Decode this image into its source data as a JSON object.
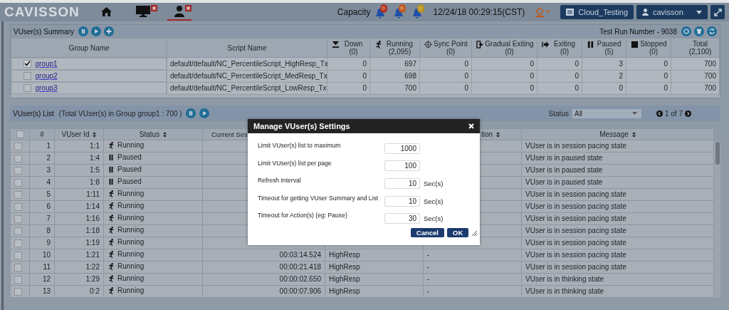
{
  "topbar": {
    "logo": "CAVISSON",
    "tabs": [
      {
        "kind": "home",
        "selected": false,
        "closable": false
      },
      {
        "kind": "monitor",
        "selected": false,
        "closable": true
      },
      {
        "kind": "user",
        "selected": true,
        "closable": true
      }
    ],
    "capacity_label": "Capacity",
    "alerts": [
      {
        "count": "0",
        "color": "#b3321f"
      },
      {
        "count": "0",
        "color": "#c0571f"
      },
      {
        "count": "0",
        "color": "#b8911c"
      }
    ],
    "datetime": "12/24/18 00:29:15(CST)",
    "project_button": "Cloud_Testing",
    "user_button": "cavisson"
  },
  "summary": {
    "title": "VUser(s) Summary",
    "test_run": "Test Run Number - 9038",
    "columns": [
      {
        "label": "Group Name",
        "kind": "text"
      },
      {
        "label": "Script Name",
        "kind": "text"
      },
      {
        "label": "Down",
        "count": "(0)",
        "kind": "down"
      },
      {
        "label": "Running",
        "count": "(2,095)",
        "kind": "running"
      },
      {
        "label": "Sync Point",
        "count": "(0)",
        "kind": "sync"
      },
      {
        "label": "Gradual Exiting",
        "count": "(0)",
        "kind": "gradual"
      },
      {
        "label": "Exiting",
        "count": "(0)",
        "kind": "exiting"
      },
      {
        "label": "Paused",
        "count": "(5)",
        "kind": "paused"
      },
      {
        "label": "Stopped",
        "count": "(0)",
        "kind": "stopped"
      },
      {
        "label": "Total",
        "count": "(2,100)",
        "kind": "total"
      }
    ],
    "rows": [
      {
        "checked": true,
        "group": "group1",
        "script": "default/default/NC_PercentileScript_HighResp_Tx",
        "values": [
          "0",
          "697",
          "0",
          "0",
          "0",
          "3",
          "0",
          "700"
        ]
      },
      {
        "checked": false,
        "group": "group2",
        "script": "default/default/NC_PercentileScript_MedResp_Tx",
        "values": [
          "0",
          "698",
          "0",
          "0",
          "0",
          "2",
          "0",
          "700"
        ]
      },
      {
        "checked": false,
        "group": "group3",
        "script": "default/default/NC_PercentileScript_LowResp_Tx",
        "values": [
          "0",
          "700",
          "0",
          "0",
          "0",
          "0",
          "0",
          "700"
        ]
      }
    ]
  },
  "vuser_list": {
    "title": "VUser(s) List",
    "subtitle": "(Total VUser(s) in Group group1 : 700 )",
    "status_filter": {
      "label": "Status",
      "value": "All"
    },
    "pager": "1 of 7",
    "all_checked": false,
    "columns": [
      {
        "label": "#",
        "sortable": false
      },
      {
        "label": "VUser Id",
        "sortable": true
      },
      {
        "label": "Status",
        "sortable": true
      },
      {
        "label": "Current Ses"
      },
      {
        "label": "tion",
        "sortable": true
      },
      {
        "label": "Message",
        "sortable": true
      }
    ],
    "rows": [
      {
        "checked": false,
        "num": "1",
        "id": "1:1",
        "status": {
          "kind": "running",
          "label": "Running"
        },
        "message": "VUser is in session pacing state"
      },
      {
        "checked": false,
        "num": "2",
        "id": "1:4",
        "status": {
          "kind": "paused",
          "label": "Paused"
        },
        "message": "VUser is in paused state"
      },
      {
        "checked": false,
        "num": "3",
        "id": "1:5",
        "status": {
          "kind": "paused",
          "label": "Paused"
        },
        "message": "VUser is in paused state"
      },
      {
        "checked": false,
        "num": "4",
        "id": "1:8",
        "status": {
          "kind": "paused",
          "label": "Paused"
        },
        "message": "VUser is in paused state"
      },
      {
        "checked": false,
        "num": "5",
        "id": "1:11",
        "status": {
          "kind": "running",
          "label": "Running"
        },
        "message": "VUser is in session pacing state"
      },
      {
        "checked": false,
        "num": "6",
        "id": "1:14",
        "status": {
          "kind": "running",
          "label": "Running"
        },
        "message": "VUser is in session pacing state"
      },
      {
        "checked": false,
        "num": "7",
        "id": "1:16",
        "status": {
          "kind": "running",
          "label": "Running"
        },
        "message": "VUser is in session pacing state"
      },
      {
        "checked": false,
        "num": "8",
        "id": "1:18",
        "status": {
          "kind": "running",
          "label": "Running"
        },
        "message": "VUser is in session pacing state"
      },
      {
        "checked": false,
        "num": "9",
        "id": "1:19",
        "status": {
          "kind": "running",
          "label": "Running"
        },
        "message": "VUser is in session pacing state"
      },
      {
        "checked": false,
        "num": "10",
        "id": "1:21",
        "status": {
          "kind": "running",
          "label": "Running"
        },
        "session_time": "00:03:14.524",
        "column_5": "HighResp",
        "column_6": "-",
        "message": "VUser is in session pacing state"
      },
      {
        "checked": false,
        "num": "11",
        "id": "1:22",
        "status": {
          "kind": "running",
          "label": "Running"
        },
        "session_time": "00:00:21.418",
        "column_5": "HighResp",
        "column_6": "-",
        "message": "VUser is in session pacing state"
      },
      {
        "checked": false,
        "num": "12",
        "id": "1:29",
        "status": {
          "kind": "running",
          "label": "Running"
        },
        "session_time": "00:00:02.650",
        "column_5": "HighResp",
        "column_6": "-",
        "message": "VUser is in thinking state"
      },
      {
        "checked": false,
        "num": "13",
        "id": "0:2",
        "status": {
          "kind": "running",
          "label": "Running"
        },
        "session_time": "00:00:07.906",
        "column_5": "HighResp",
        "column_6": "-",
        "message": "VUser is in thinking state"
      }
    ]
  },
  "dialog": {
    "title": "Manage VUser(s) Settings",
    "fields": [
      {
        "label": "Limit VUser(s) list to maximum",
        "value": "1000"
      },
      {
        "label": "Limit VUser(s) list per page",
        "value": "100"
      },
      {
        "label": "Refresh Interval",
        "value": "10",
        "unit": "Sec(s)"
      },
      {
        "label": "Timeout for getting VUser Summary and List",
        "value": "10",
        "unit": "Sec(s)"
      },
      {
        "label": "Timeout for Action(s) (eg: Pause)",
        "value": "30",
        "unit": "Sec(s)"
      }
    ],
    "buttons": [
      "Cancel",
      "OK"
    ]
  }
}
